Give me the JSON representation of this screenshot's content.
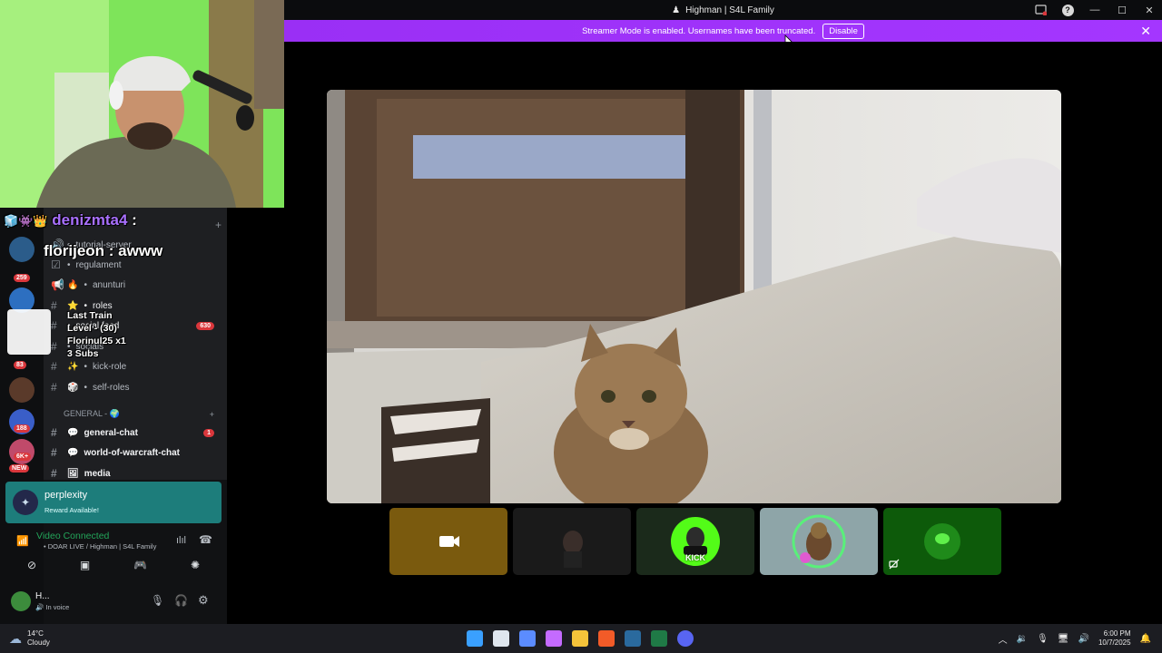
{
  "window": {
    "title": "Highman | S4L Family"
  },
  "banner": {
    "message": "Streamer Mode is enabled. Usernames have been truncated.",
    "disable_label": "Disable"
  },
  "chat_overlay": {
    "line1_user": "denizmta4",
    "line1_sep": ":",
    "line2": "florijeon : awww",
    "alert_title": "Last Train",
    "alert_level": "Level - (30)",
    "alert_user": "Florinul25 x1",
    "alert_subs": "3 Subs"
  },
  "channels": {
    "items": [
      {
        "icon": "🔊",
        "label": "tutorial-server",
        "prefix": "•"
      },
      {
        "icon": "☑",
        "label": "regulament",
        "prefix": "•"
      },
      {
        "icon": "🔥",
        "label": "anunturi",
        "prefix": "•"
      },
      {
        "icon": "⭐",
        "label": "roles",
        "prefix": "•"
      },
      {
        "icon": "",
        "label": "social feed",
        "prefix": "•",
        "badge": "630"
      },
      {
        "icon": "",
        "label": "socials",
        "prefix": "•"
      },
      {
        "icon": "✨",
        "label": "kick-role",
        "prefix": "•"
      },
      {
        "icon": "🎲",
        "label": "self-roles",
        "prefix": "•"
      }
    ],
    "category": "GENERAL - 🌍",
    "general": [
      {
        "icon": "💬",
        "label": "general-chat",
        "badge": "1"
      },
      {
        "icon": "💬",
        "label": "world-of-warcraft-chat"
      },
      {
        "icon": "🖼",
        "label": "media"
      }
    ]
  },
  "guild_badges": [
    "259",
    "83",
    "188",
    "6K+",
    "NEW"
  ],
  "promo": {
    "title": "perplexity",
    "subtitle": "Reward Available!"
  },
  "voice": {
    "status": "Video Connected",
    "channel": "DOAR LIVE / Highman | S4L Family"
  },
  "user": {
    "name": "H...",
    "status": "In voice"
  },
  "tiles": {
    "kick_label": "KICK"
  },
  "taskbar": {
    "weather_temp": "14°C",
    "weather_desc": "Cloudy",
    "time": "6:00 PM",
    "date": "10/7/2025"
  },
  "colors": {
    "banner": "#9b30ff",
    "promo": "#1d7d7b",
    "voice_green": "#23a55a",
    "badge_red": "#da373c"
  }
}
